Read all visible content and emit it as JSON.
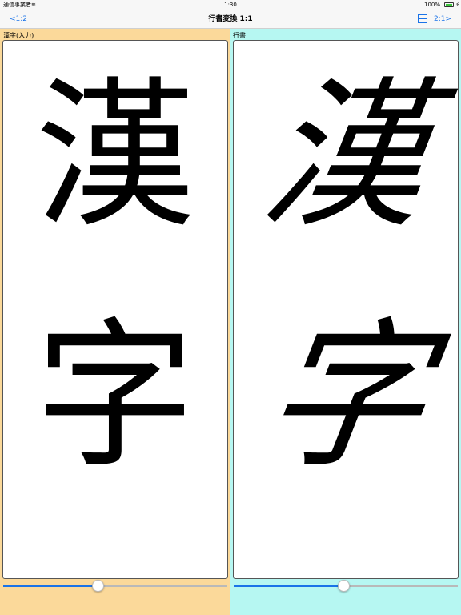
{
  "status_bar": {
    "carrier": "通信事業者",
    "time": "1:30",
    "battery_percent": "100%",
    "battery_level": 1.0
  },
  "nav": {
    "back_label": "<1:2",
    "title": "行書変換 1:1",
    "forward_label": "2:1>",
    "accent": "#1a73e8"
  },
  "left_panel": {
    "label": "漢字(入力)",
    "char1": "漢",
    "char2": "字",
    "slider_value": 0.42,
    "background": "#fbd99a"
  },
  "right_panel": {
    "label": "行書",
    "char1": "漢",
    "char2": "字",
    "slider_value": 0.49,
    "background": "#b6f7f2"
  }
}
